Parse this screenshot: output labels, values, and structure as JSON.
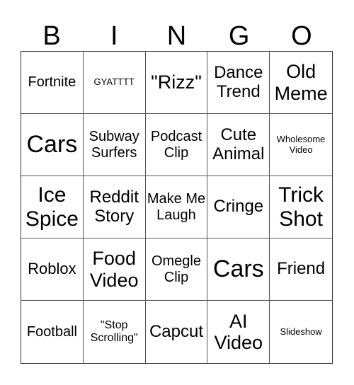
{
  "header": {
    "letters": [
      "B",
      "I",
      "N",
      "G",
      "O"
    ]
  },
  "cells": [
    "Fortnite",
    "GYATTTT",
    "\"Rizz\"",
    "Dance Trend",
    "Old Meme",
    "Cars",
    "Subway Surfers",
    "Podcast Clip",
    "Cute Animal",
    "Wholesome Video",
    "Ice Spice",
    "Reddit Story",
    "Make Me Laugh",
    "Cringe",
    "Trick Shot",
    "Roblox",
    "Food Video",
    "Omegle Clip",
    "Cars",
    "Friend",
    "Football",
    "\"Stop Scrolling\"",
    "Capcut",
    "AI Video",
    "Slideshow"
  ]
}
